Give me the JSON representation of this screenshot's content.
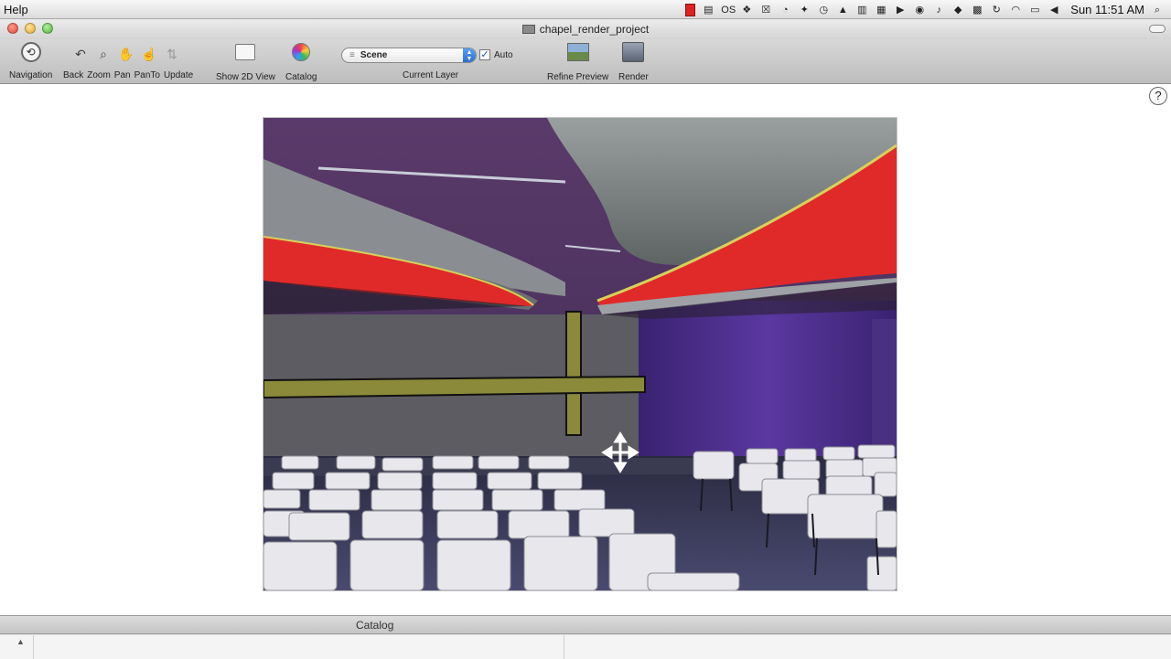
{
  "menubar": {
    "help_label": "Help",
    "clock": "Sun 11:51 AM",
    "tray_icons": [
      "red-status-icon",
      "list-icon",
      "os-icon",
      "dropbox-icon",
      "close-box-icon",
      "clock-arrow-icon",
      "dropbox-icon-2",
      "timer-icon",
      "hat-icon",
      "book-icon",
      "notes-icon",
      "play-icon",
      "record-icon",
      "bell-icon",
      "evernote-icon",
      "grid-icon",
      "sync-icon",
      "wifi-icon",
      "battery-icon",
      "volume-icon",
      "search-icon"
    ]
  },
  "window": {
    "title": "chapel_render_project"
  },
  "toolbar": {
    "navigation_label": "Navigation",
    "back_label": "Back",
    "zoom_label": "Zoom",
    "pan_label": "Pan",
    "panto_label": "PanTo",
    "update_label": "Update",
    "show2d_label": "Show 2D View",
    "catalog_label": "Catalog",
    "layer_value": "Scene",
    "auto_label": "Auto",
    "auto_checked": true,
    "current_layer_label": "Current Layer",
    "refine_label": "Refine Preview",
    "render_label": "Render"
  },
  "help_button": "?",
  "bottom": {
    "catalog_label": "Catalog"
  },
  "colors": {
    "ceiling_purple": "#5a3a6a",
    "accent_red": "#e02a2a",
    "cross_olive": "#8a8a3a",
    "wall_purple": "#4a2a8a",
    "chair_white": "#e8e8ec"
  }
}
